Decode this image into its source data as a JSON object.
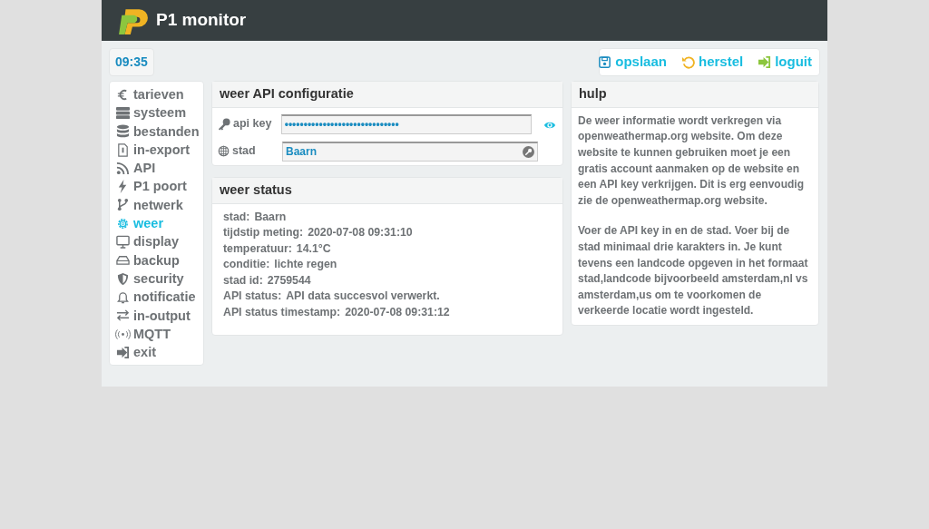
{
  "app": {
    "title": "P1 monitor"
  },
  "clock": "09:35",
  "actions": [
    {
      "label": "opslaan"
    },
    {
      "label": "herstel"
    },
    {
      "label": "loguit"
    }
  ],
  "sidebar": {
    "items": [
      {
        "label": "tarieven",
        "selected": false
      },
      {
        "label": "systeem",
        "selected": false
      },
      {
        "label": "bestanden",
        "selected": false
      },
      {
        "label": "in-export",
        "selected": false
      },
      {
        "label": "API",
        "selected": false
      },
      {
        "label": "P1 poort",
        "selected": false
      },
      {
        "label": "netwerk",
        "selected": false
      },
      {
        "label": "weer",
        "selected": true
      },
      {
        "label": "display",
        "selected": false
      },
      {
        "label": "backup",
        "selected": false
      },
      {
        "label": "security",
        "selected": false
      },
      {
        "label": "notificatie",
        "selected": false
      },
      {
        "label": "in-output",
        "selected": false
      },
      {
        "label": "MQTT",
        "selected": false
      },
      {
        "label": "exit",
        "selected": false
      }
    ]
  },
  "config": {
    "title": "weer API configuratie",
    "fields": [
      {
        "label": "api key",
        "value": "••••••••••••••••••••••••••••••"
      },
      {
        "label": "stad",
        "value": "Baarn"
      }
    ]
  },
  "status": {
    "title": "weer status",
    "lines": [
      {
        "label": "stad:",
        "value": "Baarn"
      },
      {
        "label": "tijdstip meting:",
        "value": "2020-07-08 09:31:10"
      },
      {
        "label": "temperatuur:",
        "value": "14.1°C"
      },
      {
        "label": "conditie:",
        "value": "lichte regen"
      },
      {
        "label": "stad id:",
        "value": "2759544"
      },
      {
        "label": "API status:",
        "value": "API data succesvol verwerkt."
      },
      {
        "label": "API status timestamp:",
        "value": "2020-07-08 09:31:12"
      }
    ]
  },
  "help": {
    "title": "hulp",
    "paragraphs": [
      "De weer informatie wordt verkregen via openweathermap.org website. Om deze website te kunnen gebruiken moet je een gratis account aanmaken op de website en een API key verkrijgen. Dit is erg eenvoudig zie de openweathermap.org website.",
      "Voer de API key in en de stad. Voer bij de stad minimaal drie karakters in. Je kunt tevens een landcode opgeven in het formaat stad,landcode bijvoorbeeld amsterdam,nl vs amsterdam,us om te voorkomen de verkeerde locatie wordt ingesteld."
    ]
  }
}
